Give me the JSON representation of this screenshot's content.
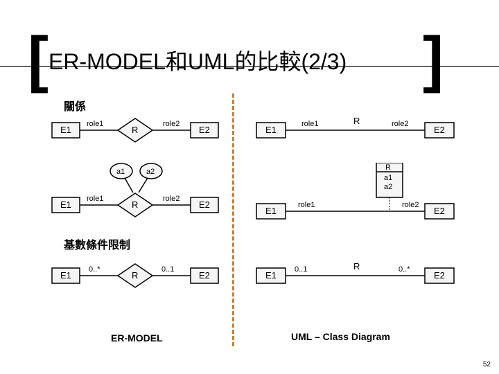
{
  "title": "ER-MODEL和UML的比較(2/3)",
  "subhead1": "關係",
  "subhead2": "基數條件限制",
  "left_label": "ER-MODEL",
  "right_label": "UML – Class Diagram",
  "page": "52",
  "labels": {
    "E1": "E1",
    "E2": "E2",
    "R": "R",
    "role1": "role1",
    "role2": "role2",
    "a1": "a1",
    "a2": "a2",
    "c1": "0..*",
    "c2": "0..1",
    "c3": "0..1",
    "c4": "0..*"
  }
}
